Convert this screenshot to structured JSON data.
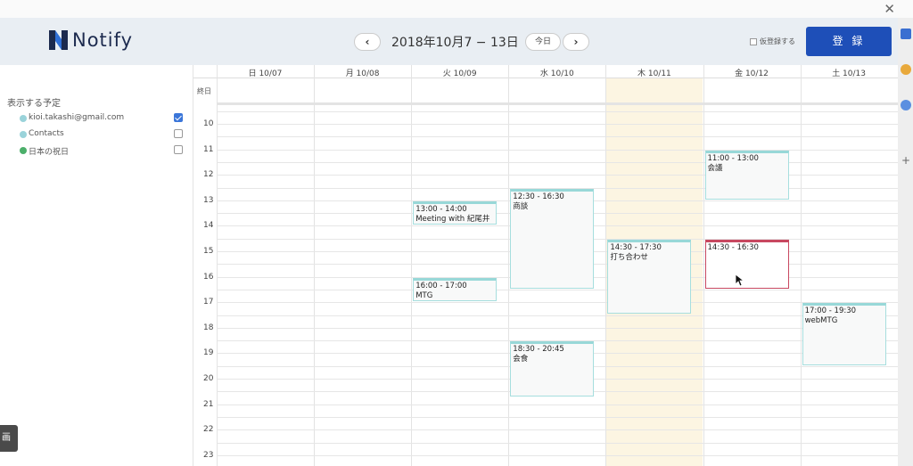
{
  "app": {
    "logo_text": "Notify"
  },
  "sidebar": {
    "section_title": "表示する予定",
    "calendars": [
      {
        "name": "kioi.takashi@gmail.com",
        "color": "#9ad3da",
        "checked": true
      },
      {
        "name": "Contacts",
        "color": "#9ad3da",
        "checked": false
      },
      {
        "name": "日本の祝日",
        "color": "#4caf6a",
        "checked": false
      }
    ],
    "screen_tab": "画"
  },
  "header": {
    "prev": "‹",
    "title": "2018年10月7 − 13日",
    "today": "今日",
    "next": "›",
    "tentative_label": "仮登録する",
    "register": "登 録"
  },
  "calendar": {
    "days": [
      "日 10/07",
      "月 10/08",
      "火 10/09",
      "水 10/10",
      "木 10/11",
      "金 10/12",
      "土 10/13"
    ],
    "highlight_day": 4,
    "allday_label": "終日",
    "hours": [
      "10",
      "11",
      "12",
      "13",
      "14",
      "15",
      "16",
      "17",
      "18",
      "19",
      "20",
      "21",
      "22",
      "23"
    ],
    "events": [
      {
        "day": 2,
        "start": 13.0,
        "end": 14.0,
        "time": "13:00 - 14:00",
        "title": "Meeting with 紀尾井孝",
        "selected": false
      },
      {
        "day": 2,
        "start": 16.0,
        "end": 17.0,
        "time": "16:00 - 17:00",
        "title": "MTG",
        "selected": false
      },
      {
        "day": 3,
        "start": 12.5,
        "end": 16.5,
        "time": "12:30 - 16:30",
        "title": "商談",
        "selected": false
      },
      {
        "day": 3,
        "start": 18.5,
        "end": 20.75,
        "time": "18:30 - 20:45",
        "title": "会食",
        "selected": false
      },
      {
        "day": 4,
        "start": 14.5,
        "end": 17.5,
        "time": "14:30 - 17:30",
        "title": "打ち合わせ",
        "selected": false
      },
      {
        "day": 5,
        "start": 11.0,
        "end": 13.0,
        "time": "11:00 - 13:00",
        "title": "会議",
        "selected": false
      },
      {
        "day": 5,
        "start": 14.5,
        "end": 16.5,
        "time": "14:30 - 16:30",
        "title": "",
        "selected": true
      },
      {
        "day": 6,
        "start": 17.0,
        "end": 19.5,
        "time": "17:00 - 19:30",
        "title": "webMTG",
        "selected": false
      }
    ]
  }
}
